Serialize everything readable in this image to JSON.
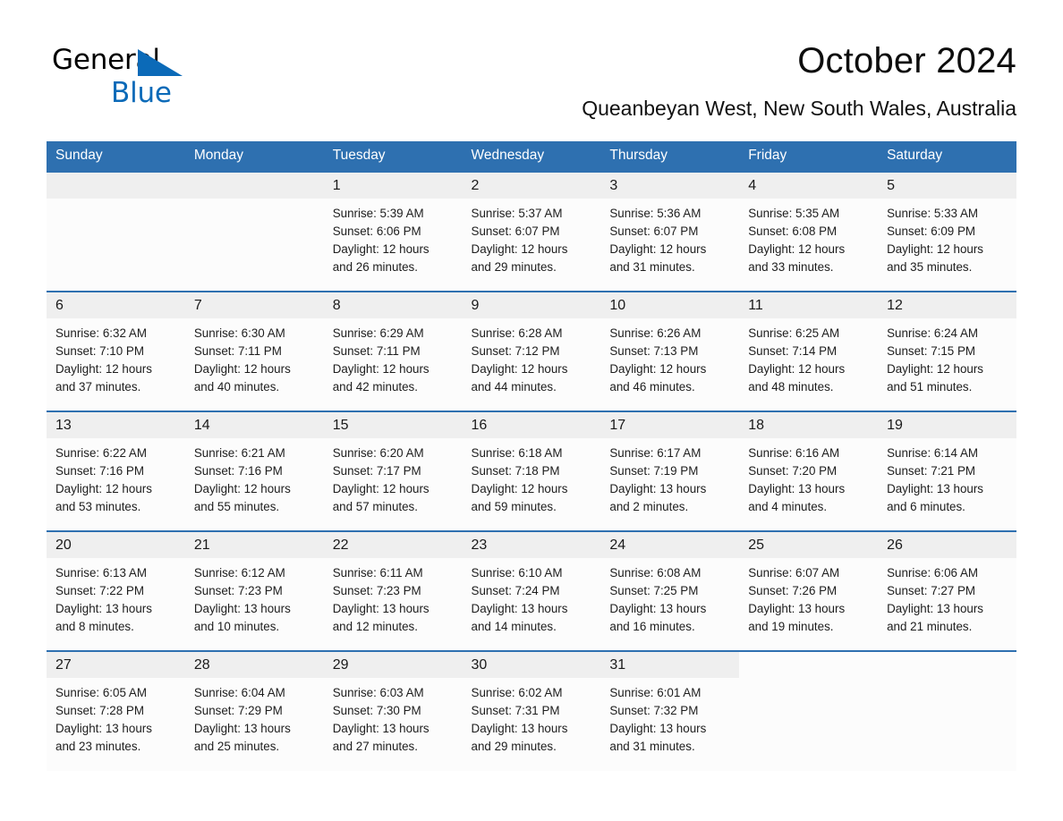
{
  "brand": {
    "name_part1": "General",
    "name_part2": "Blue",
    "triangle_color": "#0b6ab8"
  },
  "header": {
    "title": "October 2024",
    "subtitle": "Queanbeyan West, New South Wales, Australia",
    "header_bg_color": "#2e70b0"
  },
  "calendar": {
    "weekday_headers": [
      "Sunday",
      "Monday",
      "Tuesday",
      "Wednesday",
      "Thursday",
      "Friday",
      "Saturday"
    ],
    "weeks": [
      [
        {
          "day": "",
          "empty": true
        },
        {
          "day": "",
          "empty": true
        },
        {
          "day": "1",
          "sunrise": "Sunrise: 5:39 AM",
          "sunset": "Sunset: 6:06 PM",
          "daylight_line1": "Daylight: 12 hours",
          "daylight_line2": "and 26 minutes."
        },
        {
          "day": "2",
          "sunrise": "Sunrise: 5:37 AM",
          "sunset": "Sunset: 6:07 PM",
          "daylight_line1": "Daylight: 12 hours",
          "daylight_line2": "and 29 minutes."
        },
        {
          "day": "3",
          "sunrise": "Sunrise: 5:36 AM",
          "sunset": "Sunset: 6:07 PM",
          "daylight_line1": "Daylight: 12 hours",
          "daylight_line2": "and 31 minutes."
        },
        {
          "day": "4",
          "sunrise": "Sunrise: 5:35 AM",
          "sunset": "Sunset: 6:08 PM",
          "daylight_line1": "Daylight: 12 hours",
          "daylight_line2": "and 33 minutes."
        },
        {
          "day": "5",
          "sunrise": "Sunrise: 5:33 AM",
          "sunset": "Sunset: 6:09 PM",
          "daylight_line1": "Daylight: 12 hours",
          "daylight_line2": "and 35 minutes."
        }
      ],
      [
        {
          "day": "6",
          "sunrise": "Sunrise: 6:32 AM",
          "sunset": "Sunset: 7:10 PM",
          "daylight_line1": "Daylight: 12 hours",
          "daylight_line2": "and 37 minutes."
        },
        {
          "day": "7",
          "sunrise": "Sunrise: 6:30 AM",
          "sunset": "Sunset: 7:11 PM",
          "daylight_line1": "Daylight: 12 hours",
          "daylight_line2": "and 40 minutes."
        },
        {
          "day": "8",
          "sunrise": "Sunrise: 6:29 AM",
          "sunset": "Sunset: 7:11 PM",
          "daylight_line1": "Daylight: 12 hours",
          "daylight_line2": "and 42 minutes."
        },
        {
          "day": "9",
          "sunrise": "Sunrise: 6:28 AM",
          "sunset": "Sunset: 7:12 PM",
          "daylight_line1": "Daylight: 12 hours",
          "daylight_line2": "and 44 minutes."
        },
        {
          "day": "10",
          "sunrise": "Sunrise: 6:26 AM",
          "sunset": "Sunset: 7:13 PM",
          "daylight_line1": "Daylight: 12 hours",
          "daylight_line2": "and 46 minutes."
        },
        {
          "day": "11",
          "sunrise": "Sunrise: 6:25 AM",
          "sunset": "Sunset: 7:14 PM",
          "daylight_line1": "Daylight: 12 hours",
          "daylight_line2": "and 48 minutes."
        },
        {
          "day": "12",
          "sunrise": "Sunrise: 6:24 AM",
          "sunset": "Sunset: 7:15 PM",
          "daylight_line1": "Daylight: 12 hours",
          "daylight_line2": "and 51 minutes."
        }
      ],
      [
        {
          "day": "13",
          "sunrise": "Sunrise: 6:22 AM",
          "sunset": "Sunset: 7:16 PM",
          "daylight_line1": "Daylight: 12 hours",
          "daylight_line2": "and 53 minutes."
        },
        {
          "day": "14",
          "sunrise": "Sunrise: 6:21 AM",
          "sunset": "Sunset: 7:16 PM",
          "daylight_line1": "Daylight: 12 hours",
          "daylight_line2": "and 55 minutes."
        },
        {
          "day": "15",
          "sunrise": "Sunrise: 6:20 AM",
          "sunset": "Sunset: 7:17 PM",
          "daylight_line1": "Daylight: 12 hours",
          "daylight_line2": "and 57 minutes."
        },
        {
          "day": "16",
          "sunrise": "Sunrise: 6:18 AM",
          "sunset": "Sunset: 7:18 PM",
          "daylight_line1": "Daylight: 12 hours",
          "daylight_line2": "and 59 minutes."
        },
        {
          "day": "17",
          "sunrise": "Sunrise: 6:17 AM",
          "sunset": "Sunset: 7:19 PM",
          "daylight_line1": "Daylight: 13 hours",
          "daylight_line2": "and 2 minutes."
        },
        {
          "day": "18",
          "sunrise": "Sunrise: 6:16 AM",
          "sunset": "Sunset: 7:20 PM",
          "daylight_line1": "Daylight: 13 hours",
          "daylight_line2": "and 4 minutes."
        },
        {
          "day": "19",
          "sunrise": "Sunrise: 6:14 AM",
          "sunset": "Sunset: 7:21 PM",
          "daylight_line1": "Daylight: 13 hours",
          "daylight_line2": "and 6 minutes."
        }
      ],
      [
        {
          "day": "20",
          "sunrise": "Sunrise: 6:13 AM",
          "sunset": "Sunset: 7:22 PM",
          "daylight_line1": "Daylight: 13 hours",
          "daylight_line2": "and 8 minutes."
        },
        {
          "day": "21",
          "sunrise": "Sunrise: 6:12 AM",
          "sunset": "Sunset: 7:23 PM",
          "daylight_line1": "Daylight: 13 hours",
          "daylight_line2": "and 10 minutes."
        },
        {
          "day": "22",
          "sunrise": "Sunrise: 6:11 AM",
          "sunset": "Sunset: 7:23 PM",
          "daylight_line1": "Daylight: 13 hours",
          "daylight_line2": "and 12 minutes."
        },
        {
          "day": "23",
          "sunrise": "Sunrise: 6:10 AM",
          "sunset": "Sunset: 7:24 PM",
          "daylight_line1": "Daylight: 13 hours",
          "daylight_line2": "and 14 minutes."
        },
        {
          "day": "24",
          "sunrise": "Sunrise: 6:08 AM",
          "sunset": "Sunset: 7:25 PM",
          "daylight_line1": "Daylight: 13 hours",
          "daylight_line2": "and 16 minutes."
        },
        {
          "day": "25",
          "sunrise": "Sunrise: 6:07 AM",
          "sunset": "Sunset: 7:26 PM",
          "daylight_line1": "Daylight: 13 hours",
          "daylight_line2": "and 19 minutes."
        },
        {
          "day": "26",
          "sunrise": "Sunrise: 6:06 AM",
          "sunset": "Sunset: 7:27 PM",
          "daylight_line1": "Daylight: 13 hours",
          "daylight_line2": "and 21 minutes."
        }
      ],
      [
        {
          "day": "27",
          "sunrise": "Sunrise: 6:05 AM",
          "sunset": "Sunset: 7:28 PM",
          "daylight_line1": "Daylight: 13 hours",
          "daylight_line2": "and 23 minutes."
        },
        {
          "day": "28",
          "sunrise": "Sunrise: 6:04 AM",
          "sunset": "Sunset: 7:29 PM",
          "daylight_line1": "Daylight: 13 hours",
          "daylight_line2": "and 25 minutes."
        },
        {
          "day": "29",
          "sunrise": "Sunrise: 6:03 AM",
          "sunset": "Sunset: 7:30 PM",
          "daylight_line1": "Daylight: 13 hours",
          "daylight_line2": "and 27 minutes."
        },
        {
          "day": "30",
          "sunrise": "Sunrise: 6:02 AM",
          "sunset": "Sunset: 7:31 PM",
          "daylight_line1": "Daylight: 13 hours",
          "daylight_line2": "and 29 minutes."
        },
        {
          "day": "31",
          "sunrise": "Sunrise: 6:01 AM",
          "sunset": "Sunset: 7:32 PM",
          "daylight_line1": "Daylight: 13 hours",
          "daylight_line2": "and 31 minutes."
        },
        {
          "day": "",
          "empty": true,
          "no_band": true
        },
        {
          "day": "",
          "empty": true,
          "no_band": true
        }
      ]
    ]
  }
}
